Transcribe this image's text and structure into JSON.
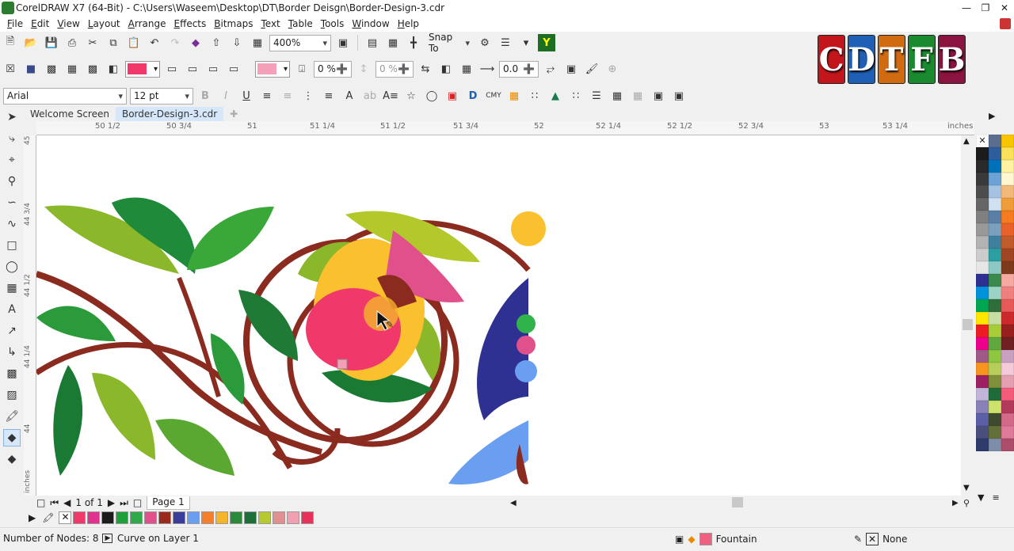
{
  "window": {
    "title": "CorelDRAW X7 (64-Bit) - C:\\Users\\Waseem\\Desktop\\DT\\Border Deisgn\\Border-Design-3.cdr"
  },
  "menu": [
    "File",
    "Edit",
    "View",
    "Layout",
    "Arrange",
    "Effects",
    "Bitmaps",
    "Text",
    "Table",
    "Tools",
    "Window",
    "Help"
  ],
  "standard_toolbar": {
    "zoom": "400%",
    "snap_to": "Snap To"
  },
  "property_bar": {
    "fill_value": "0 %",
    "transparency_value": "0 %",
    "outline_value": "0.0"
  },
  "text_bar": {
    "font": "Arial",
    "size": "12 pt"
  },
  "logo_letters": [
    "C",
    "D",
    "T",
    "F",
    "B"
  ],
  "logo_colors": [
    "#c3161c",
    "#1f5fb5",
    "#d06b12",
    "#1a8a2e",
    "#8a1340"
  ],
  "doc_tabs": [
    {
      "label": "Welcome Screen"
    },
    {
      "label": "Border-Design-3.cdr"
    }
  ],
  "ruler": {
    "h_labels": [
      "50 1/2",
      "50 3/4",
      "51",
      "51 1/4",
      "51 1/2",
      "51 3/4",
      "52",
      "52 1/4",
      "52 1/2",
      "52 3/4",
      "53",
      "53 1/4"
    ],
    "h_unit": "inches",
    "v_labels": [
      "45",
      "44 3/4",
      "44 1/2",
      "44 1/4",
      "44"
    ],
    "v_unit": "inches"
  },
  "page_nav": {
    "page_count": "1 of 1",
    "page_tab": "Page 1"
  },
  "palette_colors": [
    "#ffffff",
    "#5c6e8f",
    "#f9c400",
    "#1b1b1b",
    "#2e5d9e",
    "#fbe15a",
    "#2a2a2a",
    "#0072bc",
    "#fff2a0",
    "#3a3a3a",
    "#6ba3d6",
    "#fff8d0",
    "#4d4d4d",
    "#a4c3e3",
    "#f3b97a",
    "#666666",
    "#cfe0f0",
    "#ef9d3a",
    "#808080",
    "#5a7fa6",
    "#f47b20",
    "#999999",
    "#7aa0bf",
    "#e8622a",
    "#b3b3b3",
    "#3f7fa0",
    "#c15d2a",
    "#cccccc",
    "#2c9fa2",
    "#a04623",
    "#e6e6e6",
    "#8cc9c5",
    "#7f3a1c",
    "#2e3192",
    "#3b8a4d",
    "#f6a9a0",
    "#0093dd",
    "#9ad3c3",
    "#f08080",
    "#00a651",
    "#2e6e3a",
    "#e85a5a",
    "#ffe600",
    "#c6e0a3",
    "#cc2a2a",
    "#ed1c24",
    "#a6ce39",
    "#991f1f",
    "#ec008c",
    "#5fa83e",
    "#702020",
    "#a05a88",
    "#8dc63f",
    "#c9a0c0",
    "#f7941d",
    "#b5cf5a",
    "#f4c9d9",
    "#9e1f63",
    "#7f8f3a",
    "#e4a0b0",
    "#c2b5d9",
    "#1f6b3a",
    "#f25c7a",
    "#8882b8",
    "#cde26b",
    "#b33a5a",
    "#5b5fa6",
    "#3d4a2b",
    "#d46a8a",
    "#4b4f7e",
    "#63703a",
    "#e07a9a",
    "#2f3b6a",
    "#7d8ca8",
    "#ad4d6b"
  ],
  "doc_palette": [
    "#f0386b",
    "#e0318f",
    "#1c1c1c",
    "#1f9e3a",
    "#31a84a",
    "#e0508a",
    "#9a2a1e",
    "#3a3c9a",
    "#6a9ef0",
    "#f57f2a",
    "#f5b52a",
    "#2a8a3a",
    "#1e6e3a",
    "#b8c830",
    "#e09090",
    "#f0a0b0",
    "#e8305a"
  ],
  "status": {
    "nodes": "Number of Nodes: 8",
    "object": "Curve on Layer 1",
    "fill": "Fountain",
    "outline": "None"
  }
}
